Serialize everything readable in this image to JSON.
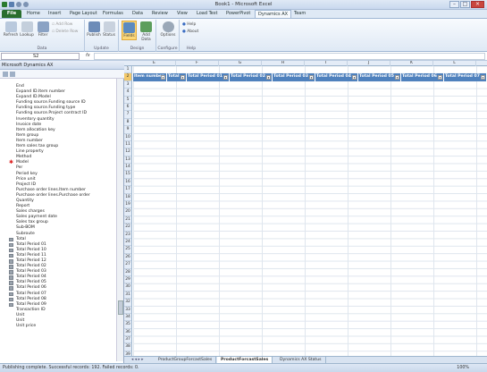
{
  "window": {
    "title": "Book1 - Microsoft Excel"
  },
  "tabs": [
    "File",
    "Home",
    "Insert",
    "Page Layout",
    "Formulas",
    "Data",
    "Review",
    "View",
    "Load Test",
    "PowerPivot",
    "Dynamics AX",
    "Team"
  ],
  "ribbon": {
    "data_group": {
      "label": "Data",
      "buttons": [
        "Refresh",
        "Lookup",
        "Filter"
      ],
      "small": [
        "Add Row",
        "Delete Row"
      ]
    },
    "update_group": {
      "label": "Update",
      "buttons": [
        "Publish",
        "Status"
      ]
    },
    "design_group": {
      "label": "Design",
      "buttons": [
        "Fields",
        "Add Data"
      ]
    },
    "configure_group": {
      "label": "Configure",
      "buttons": [
        "Options"
      ]
    },
    "help_group": {
      "label": "Help",
      "buttons": [
        "Help",
        "About"
      ]
    }
  },
  "formula_bar": {
    "name_box": "S2",
    "fx": "fx"
  },
  "pane": {
    "title": "Microsoft Dynamics AX",
    "fields": [
      {
        "label": "End",
        "mark": ""
      },
      {
        "label": "Expand ID.Item number",
        "mark": ""
      },
      {
        "label": "Expand ID.Model",
        "mark": ""
      },
      {
        "label": "Funding source.Funding source ID",
        "mark": ""
      },
      {
        "label": "Funding source.Funding type",
        "mark": ""
      },
      {
        "label": "Funding source.Project contract ID",
        "mark": ""
      },
      {
        "label": "Inventory quantity",
        "mark": ""
      },
      {
        "label": "Invoice date",
        "mark": ""
      },
      {
        "label": "Item allocation key",
        "mark": ""
      },
      {
        "label": "Item group",
        "mark": ""
      },
      {
        "label": "Item number",
        "mark": ""
      },
      {
        "label": "Item sales tax group",
        "mark": ""
      },
      {
        "label": "Line property",
        "mark": ""
      },
      {
        "label": "Method",
        "mark": ""
      },
      {
        "label": "Model",
        "mark": "star"
      },
      {
        "label": "Per",
        "mark": ""
      },
      {
        "label": "Period key",
        "mark": ""
      },
      {
        "label": "Price unit",
        "mark": ""
      },
      {
        "label": "Project ID",
        "mark": ""
      },
      {
        "label": "Purchase order lines.Item number",
        "mark": ""
      },
      {
        "label": "Purchase order lines.Purchase order",
        "mark": ""
      },
      {
        "label": "Quantity",
        "mark": ""
      },
      {
        "label": "Report",
        "mark": ""
      },
      {
        "label": "Sales charges",
        "mark": ""
      },
      {
        "label": "Sales payment date",
        "mark": ""
      },
      {
        "label": "Sales tax group",
        "mark": ""
      },
      {
        "label": "Sub-BOM",
        "mark": ""
      },
      {
        "label": "Subroute",
        "mark": ""
      },
      {
        "label": "Total",
        "mark": "box"
      },
      {
        "label": "Total Period 01",
        "mark": "box"
      },
      {
        "label": "Total Period 10",
        "mark": "box"
      },
      {
        "label": "Total Period 11",
        "mark": "box"
      },
      {
        "label": "Total Period 12",
        "mark": "box"
      },
      {
        "label": "Total Period 02",
        "mark": "box"
      },
      {
        "label": "Total Period 03",
        "mark": "box"
      },
      {
        "label": "Total Period 04",
        "mark": "box"
      },
      {
        "label": "Total Period 05",
        "mark": "box"
      },
      {
        "label": "Total Period 06",
        "mark": "box"
      },
      {
        "label": "Total Period 07",
        "mark": "box"
      },
      {
        "label": "Total Period 08",
        "mark": "box"
      },
      {
        "label": "Total Period 09",
        "mark": "box"
      },
      {
        "label": "Transaction ID",
        "mark": ""
      },
      {
        "label": "Unit",
        "mark": ""
      },
      {
        "label": "Unit",
        "mark": ""
      },
      {
        "label": "Unit price",
        "mark": ""
      }
    ]
  },
  "grid": {
    "columns": [
      "E",
      "F",
      "G",
      "H",
      "I",
      "J",
      "K",
      "L"
    ],
    "header_cells": [
      "Item number",
      "Total",
      "Total Period 01",
      "Total Period 02",
      "Total Period 03",
      "Total Period 04",
      "Total Period 05",
      "Total Period 06",
      "Total Period 07"
    ],
    "row_numbers": [
      "1",
      "2",
      "3",
      "4",
      "5",
      "6",
      "7",
      "8",
      "9",
      "10",
      "11",
      "12",
      "13",
      "14",
      "15",
      "16",
      "17",
      "18",
      "19",
      "20",
      "21",
      "22",
      "23",
      "24",
      "25",
      "26",
      "27",
      "28",
      "29",
      "30",
      "31",
      "32",
      "33",
      "34",
      "35",
      "36",
      "37",
      "38",
      "39"
    ]
  },
  "sheet_tabs": [
    "ProductGroupForcastSales",
    "ProductForcastSales",
    "Dynamics AX Status"
  ],
  "status": {
    "text": "Publishing complete. Successful records: 192. Failed records: 0.",
    "zoom": "100%"
  }
}
